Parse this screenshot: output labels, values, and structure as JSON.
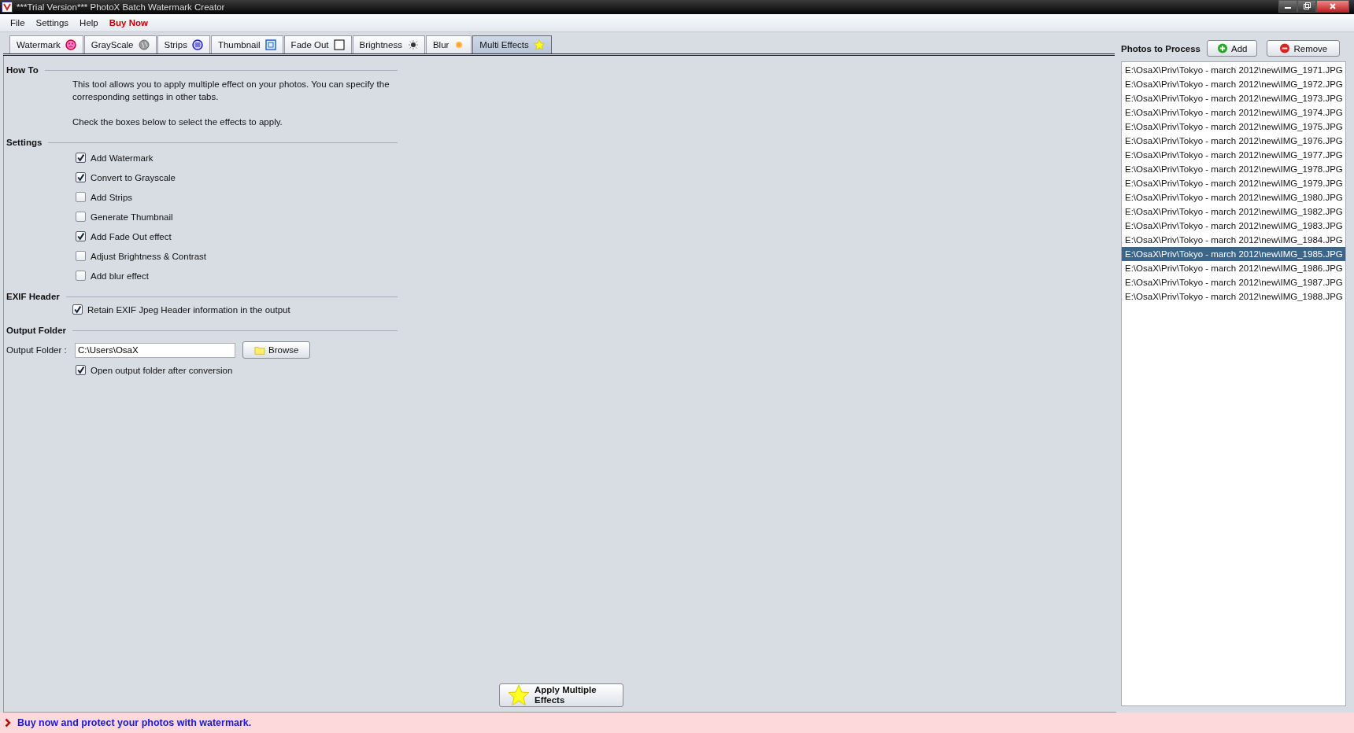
{
  "window": {
    "title": "***Trial Version*** PhotoX Batch Watermark Creator"
  },
  "menu": [
    {
      "label": "File",
      "kind": "normal"
    },
    {
      "label": "Settings",
      "kind": "normal"
    },
    {
      "label": "Help",
      "kind": "normal"
    },
    {
      "label": "Buy Now",
      "kind": "promo"
    }
  ],
  "tabs": [
    {
      "label": "Watermark",
      "selected": false
    },
    {
      "label": "GrayScale",
      "selected": false
    },
    {
      "label": "Strips",
      "selected": false
    },
    {
      "label": "Thumbnail",
      "selected": false
    },
    {
      "label": "Fade Out",
      "selected": false
    },
    {
      "label": "Brightness",
      "selected": false
    },
    {
      "label": "Blur",
      "selected": false
    },
    {
      "label": "Multi Effects",
      "selected": true
    }
  ],
  "how_to": {
    "heading": "How To",
    "text": "This tool allows you to apply multiple effect on your photos. You can specify the corresponding settings in other tabs.",
    "hint": "Check the boxes below to select the effects to apply."
  },
  "settings": {
    "heading": "Settings",
    "options": [
      {
        "label": "Add Watermark",
        "checked": true
      },
      {
        "label": "Convert to Grayscale",
        "checked": true
      },
      {
        "label": "Add Strips",
        "checked": false
      },
      {
        "label": "Generate Thumbnail",
        "checked": false
      },
      {
        "label": "Add Fade Out effect",
        "checked": true
      },
      {
        "label": "Adjust Brightness & Contrast",
        "checked": false
      },
      {
        "label": "Add blur effect",
        "checked": false
      }
    ]
  },
  "exif": {
    "heading": "EXIF Header",
    "option": {
      "label": "Retain EXIF Jpeg Header information in the output",
      "checked": true
    }
  },
  "output": {
    "heading": "Output Folder",
    "label": "Output Folder :",
    "value": "C:\\Users\\OsaX",
    "browse": "Browse",
    "open_after": {
      "label": "Open output folder after conversion",
      "checked": true
    }
  },
  "apply_button": "Apply Multiple Effects",
  "photos": {
    "heading": "Photos to Process",
    "add": "Add",
    "remove": "Remove",
    "files": [
      {
        "path": "E:\\OsaX\\Priv\\Tokyo - march 2012\\new\\IMG_1971.JPG",
        "selected": false
      },
      {
        "path": "E:\\OsaX\\Priv\\Tokyo - march 2012\\new\\IMG_1972.JPG",
        "selected": false
      },
      {
        "path": "E:\\OsaX\\Priv\\Tokyo - march 2012\\new\\IMG_1973.JPG",
        "selected": false
      },
      {
        "path": "E:\\OsaX\\Priv\\Tokyo - march 2012\\new\\IMG_1974.JPG",
        "selected": false
      },
      {
        "path": "E:\\OsaX\\Priv\\Tokyo - march 2012\\new\\IMG_1975.JPG",
        "selected": false
      },
      {
        "path": "E:\\OsaX\\Priv\\Tokyo - march 2012\\new\\IMG_1976.JPG",
        "selected": false
      },
      {
        "path": "E:\\OsaX\\Priv\\Tokyo - march 2012\\new\\IMG_1977.JPG",
        "selected": false
      },
      {
        "path": "E:\\OsaX\\Priv\\Tokyo - march 2012\\new\\IMG_1978.JPG",
        "selected": false
      },
      {
        "path": "E:\\OsaX\\Priv\\Tokyo - march 2012\\new\\IMG_1979.JPG",
        "selected": false
      },
      {
        "path": "E:\\OsaX\\Priv\\Tokyo - march 2012\\new\\IMG_1980.JPG",
        "selected": false
      },
      {
        "path": "E:\\OsaX\\Priv\\Tokyo - march 2012\\new\\IMG_1982.JPG",
        "selected": false
      },
      {
        "path": "E:\\OsaX\\Priv\\Tokyo - march 2012\\new\\IMG_1983.JPG",
        "selected": false
      },
      {
        "path": "E:\\OsaX\\Priv\\Tokyo - march 2012\\new\\IMG_1984.JPG",
        "selected": false
      },
      {
        "path": "E:\\OsaX\\Priv\\Tokyo - march 2012\\new\\IMG_1985.JPG",
        "selected": true
      },
      {
        "path": "E:\\OsaX\\Priv\\Tokyo - march 2012\\new\\IMG_1986.JPG",
        "selected": false
      },
      {
        "path": "E:\\OsaX\\Priv\\Tokyo - march 2012\\new\\IMG_1987.JPG",
        "selected": false
      },
      {
        "path": "E:\\OsaX\\Priv\\Tokyo - march 2012\\new\\IMG_1988.JPG",
        "selected": false
      }
    ]
  },
  "status_bar": {
    "message": "Buy now and protect your photos with watermark."
  }
}
